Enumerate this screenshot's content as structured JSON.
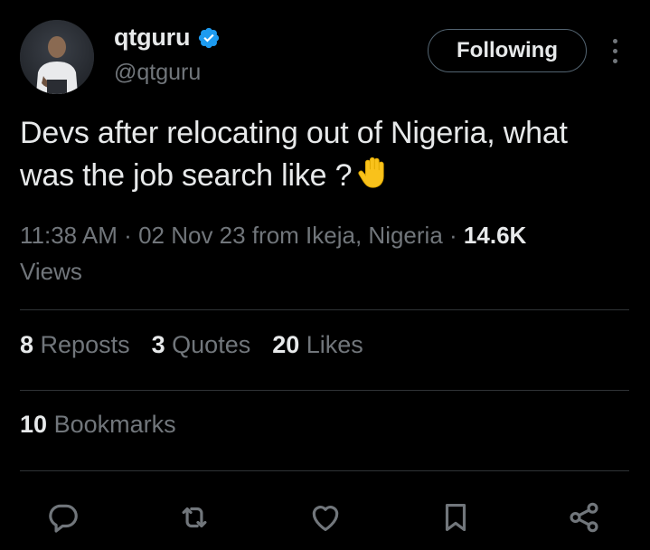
{
  "author": {
    "display_name": "qtguru",
    "handle": "@qtguru",
    "verified": true
  },
  "follow_button": {
    "label": "Following"
  },
  "tweet": {
    "text_line1": "Devs after relocating out of Nigeria, what",
    "text_line2": "was the job search like ?",
    "emoji": "raised-hand"
  },
  "meta": {
    "time": "11:38 AM",
    "date": "02 Nov 23",
    "location": "from Ikeja, Nigeria",
    "views_count": "14.6K",
    "views_label": "Views"
  },
  "stats": {
    "reposts_count": "8",
    "reposts_label": "Reposts",
    "quotes_count": "3",
    "quotes_label": "Quotes",
    "likes_count": "20",
    "likes_label": "Likes",
    "bookmarks_count": "10",
    "bookmarks_label": "Bookmarks"
  },
  "actions": [
    "reply-icon",
    "repost-icon",
    "like-icon",
    "bookmark-icon",
    "share-icon"
  ],
  "colors": {
    "background": "#000000",
    "text_primary": "#e7e9ea",
    "text_secondary": "#71767b",
    "divider": "#2f3336",
    "verified": "#1d9bf0"
  }
}
